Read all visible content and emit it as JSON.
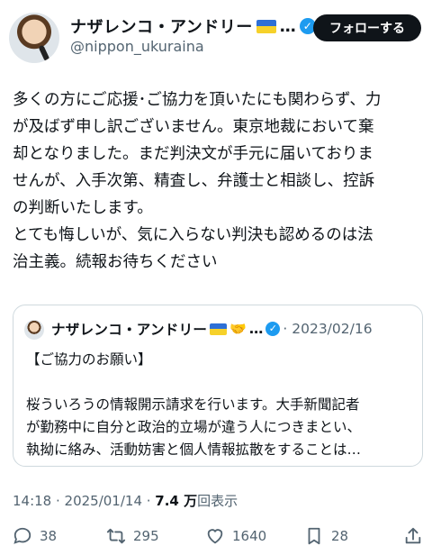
{
  "author": {
    "display_name": "ナザレンコ・アンドリー",
    "name_suffix": "…",
    "handle": "@nippon_ukuraina",
    "follow_label": "フォローする"
  },
  "tweet": {
    "text": "多くの方にご応援･ご協力を頂いたにも関わらず、力\nが及ばず申し訳ございません。東京地裁において棄\n却となりました。まだ判決文が手元に届いておりま\nせんが、入手次第、精査し、弁護士と相談し、控訴\nの判断いたします。\nとても悔しいが、気に入らない判決も認めるのは法\n治主義。続報お待ちください"
  },
  "quoted": {
    "display_name": "ナザレンコ・アンドリー",
    "name_suffix": "…",
    "date": "· 2023/02/16",
    "text": "【ご協力のお願い】\n\n桜ういろうの情報開示請求を行います。大手新聞記者\nが勤務中に自分と政治的立場が違う人につきまとい、\n執拗に絡み、活動妨害と個人情報拡散をすることは…"
  },
  "meta": {
    "time_date": "14:18 · 2025/01/14 · ",
    "views_count": "7.4 万",
    "views_label": "回表示"
  },
  "actions": {
    "replies": "38",
    "retweets": "295",
    "likes": "1640",
    "bookmarks": "28"
  },
  "colors": {
    "verified": "#1d9bf0",
    "flag_blue": "#2d6fd6",
    "flag_yellow": "#f6d12a",
    "secondary_text": "#536471"
  }
}
